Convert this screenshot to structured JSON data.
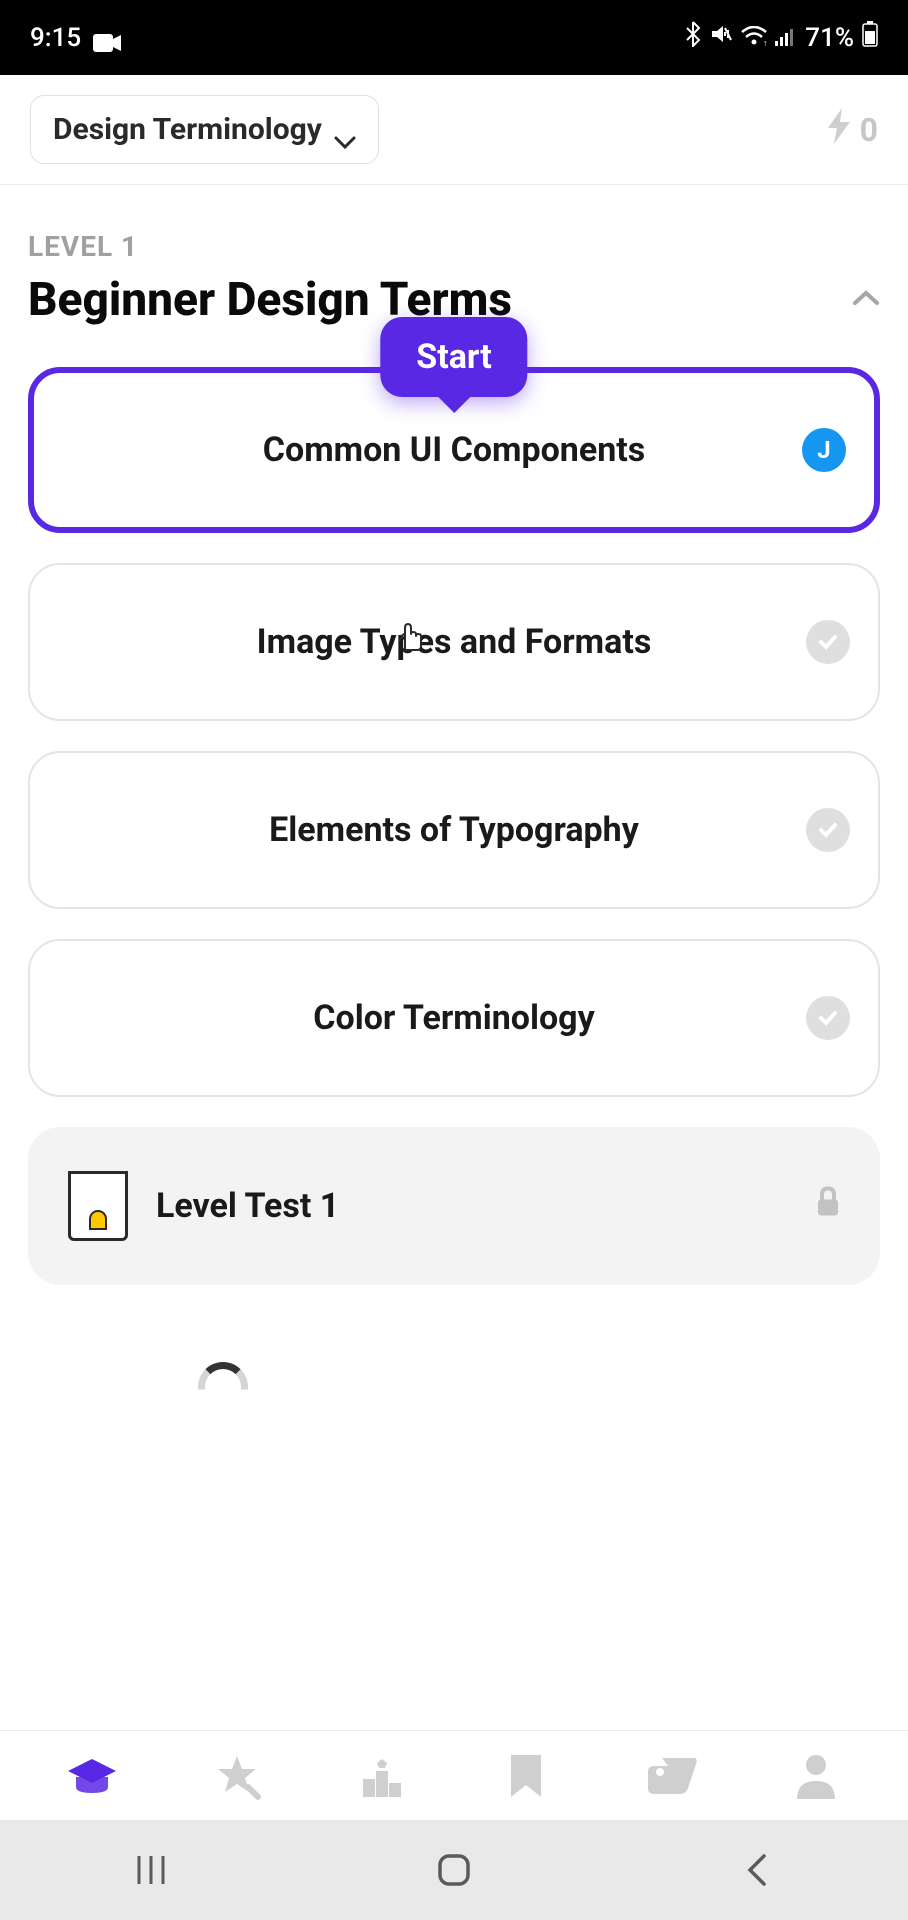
{
  "status_bar": {
    "time": "9:15",
    "battery_percent": "71%"
  },
  "header": {
    "course_name": "Design Terminology",
    "streak_count": "0"
  },
  "level": {
    "label": "LEVEL 1",
    "title": "Beginner Design Terms"
  },
  "tooltip": {
    "start": "Start"
  },
  "lessons": [
    {
      "title": "Common UI Components",
      "badge_letter": "J"
    },
    {
      "title": "Image Types and Formats"
    },
    {
      "title": "Elements of Typography"
    },
    {
      "title": "Color Terminology"
    }
  ],
  "test": {
    "title": "Level Test 1"
  }
}
